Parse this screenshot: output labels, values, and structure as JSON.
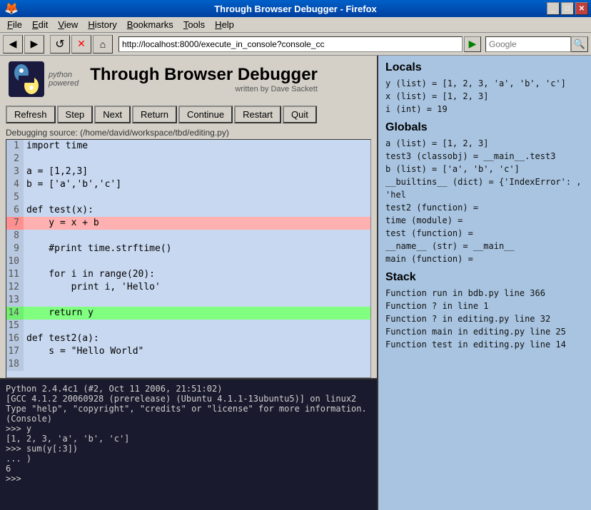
{
  "window": {
    "title": "Through Browser Debugger - Firefox",
    "controls": [
      "minimize",
      "maximize",
      "close"
    ]
  },
  "menubar": {
    "items": [
      {
        "label": "File",
        "underline": "F"
      },
      {
        "label": "Edit",
        "underline": "E"
      },
      {
        "label": "View",
        "underline": "V"
      },
      {
        "label": "History",
        "underline": "H"
      },
      {
        "label": "Bookmarks",
        "underline": "B"
      },
      {
        "label": "Tools",
        "underline": "T"
      },
      {
        "label": "Help",
        "underline": "H"
      }
    ]
  },
  "toolbar": {
    "back_label": "◀",
    "forward_label": "▶",
    "reload_label": "↺",
    "stop_label": "✕",
    "home_label": "⌂",
    "address": "http://localhost:8000/execute_in_console?console_cc",
    "go_label": "▶",
    "search_placeholder": "Google",
    "search_label": "🔍"
  },
  "header": {
    "app_title": "Through Browser Debugger",
    "written_by": "written by Dave Sackett"
  },
  "debug_buttons": [
    {
      "id": "refresh",
      "label": "Refresh"
    },
    {
      "id": "step",
      "label": "Step"
    },
    {
      "id": "next",
      "label": "Next"
    },
    {
      "id": "return",
      "label": "Return"
    },
    {
      "id": "continue",
      "label": "Continue"
    },
    {
      "id": "restart",
      "label": "Restart"
    },
    {
      "id": "quit",
      "label": "Quit"
    }
  ],
  "debug_source": "Debugging source: (/home/david/workspace/tbd/editing.py)",
  "code_lines": [
    {
      "num": 1,
      "content": "import time",
      "highlight": ""
    },
    {
      "num": 2,
      "content": "",
      "highlight": ""
    },
    {
      "num": 3,
      "content": "a = [1,2,3]",
      "highlight": ""
    },
    {
      "num": 4,
      "content": "b = ['a','b','c']",
      "highlight": ""
    },
    {
      "num": 5,
      "content": "",
      "highlight": ""
    },
    {
      "num": 6,
      "content": "def test(x):",
      "highlight": ""
    },
    {
      "num": 7,
      "content": "    y = x + b",
      "highlight": "pink"
    },
    {
      "num": 8,
      "content": "",
      "highlight": ""
    },
    {
      "num": 9,
      "content": "    #print time.strftime()",
      "highlight": ""
    },
    {
      "num": 10,
      "content": "",
      "highlight": ""
    },
    {
      "num": 11,
      "content": "    for i in range(20):",
      "highlight": ""
    },
    {
      "num": 12,
      "content": "        print i, 'Hello'",
      "highlight": ""
    },
    {
      "num": 13,
      "content": "",
      "highlight": ""
    },
    {
      "num": 14,
      "content": "    return y",
      "highlight": "green"
    },
    {
      "num": 15,
      "content": "",
      "highlight": ""
    },
    {
      "num": 16,
      "content": "def test2(a):",
      "highlight": ""
    },
    {
      "num": 17,
      "content": "    s = \"Hello World\"",
      "highlight": ""
    },
    {
      "num": 18,
      "content": "",
      "highlight": ""
    }
  ],
  "console": {
    "lines": [
      "Python 2.4.4c1 (#2, Oct 11 2006, 21:51:02)",
      "[GCC 4.1.2 20060928 (prerelease) (Ubuntu 4.1.1-13ubuntu5)] on linux2",
      "Type \"help\", \"copyright\", \"credits\" or \"license\" for more information.",
      "(Console)",
      ">>> y",
      "[1, 2, 3, 'a', 'b', 'c']",
      ">>> sum(y[:3])",
      "... )",
      "6",
      ">>> "
    ]
  },
  "right_panel": {
    "locals_title": "Locals",
    "locals_items": [
      "y (list) = [1, 2, 3, 'a', 'b', 'c']",
      "x (list) = [1, 2, 3]",
      "i (int) = 19"
    ],
    "globals_title": "Globals",
    "globals_items": [
      "a (list) = [1, 2, 3]",
      "test3 (classobj) = __main__.test3",
      "b (list) = ['a', 'b', 'c']",
      "__builtins__ (dict) = {'IndexError': , 'hel",
      "test2 (function) =",
      "time (module) =",
      "test (function) =",
      "__name__ (str) = __main__",
      "main (function) ="
    ],
    "stack_title": "Stack",
    "stack_items": [
      "Function run in bdb.py line 366",
      "Function ? in  line 1",
      "Function ? in editing.py line 32",
      "Function main in editing.py line 25",
      "Function test in editing.py line 14"
    ]
  }
}
